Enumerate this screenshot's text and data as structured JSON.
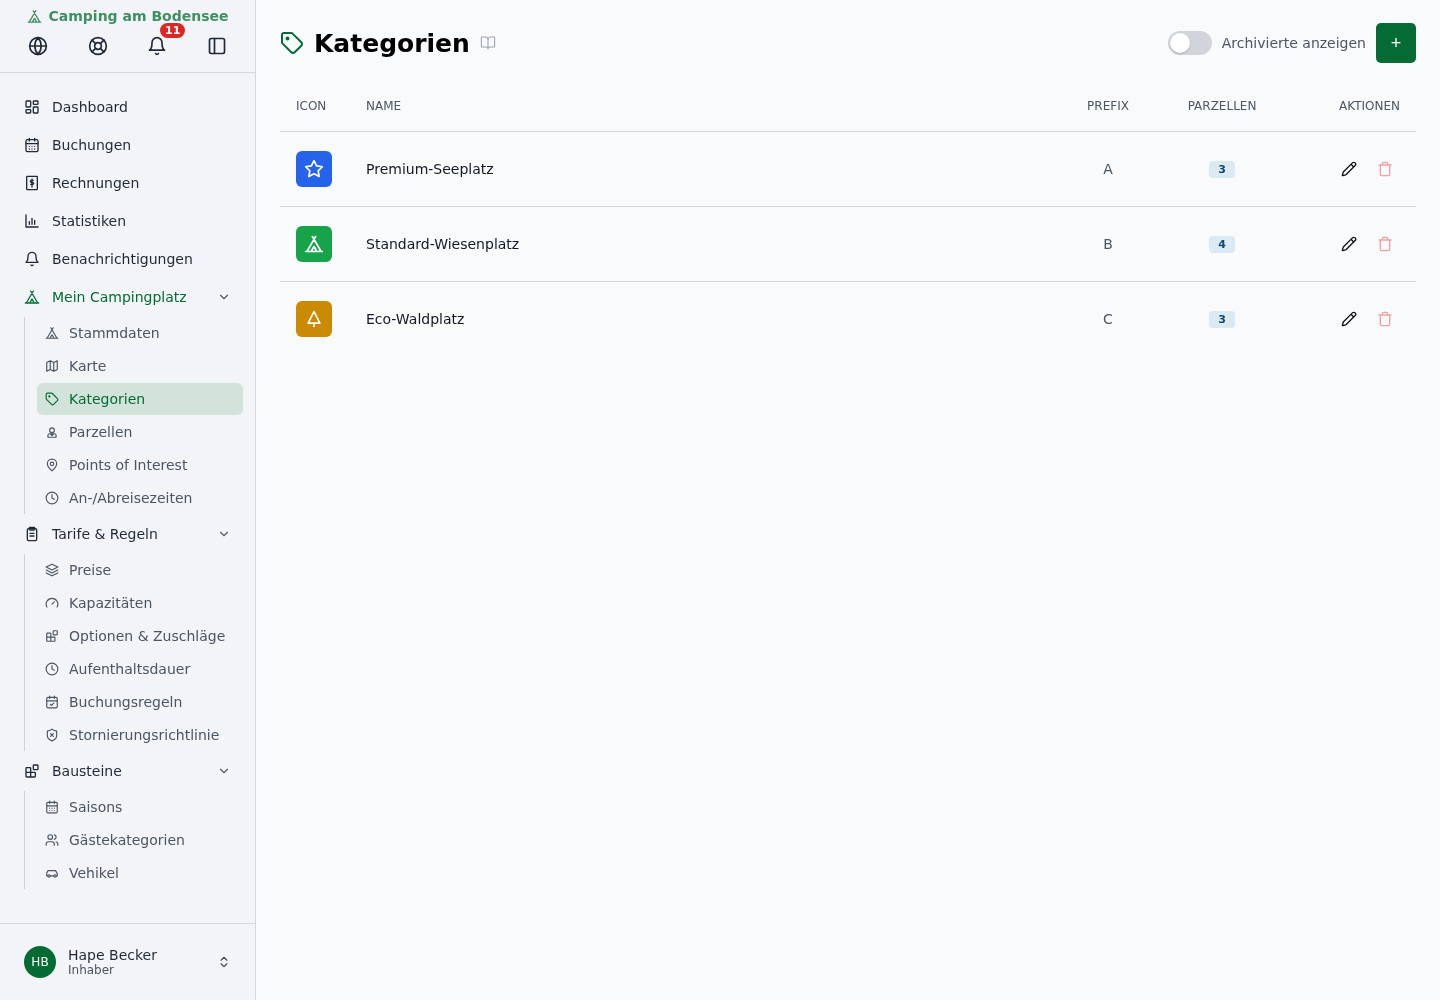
{
  "sidebar": {
    "brand": "Camping am Bodensee",
    "notifications_badge": "11",
    "nav": [
      {
        "label": "Dashboard",
        "selected": false
      },
      {
        "label": "Buchungen",
        "selected": false
      },
      {
        "label": "Rechnungen",
        "selected": false
      },
      {
        "label": "Statistiken",
        "selected": false
      },
      {
        "label": "Benachrichtigungen",
        "selected": false
      },
      {
        "label": "Mein Campingplatz",
        "selected": true,
        "expanded": true,
        "children": [
          {
            "label": "Stammdaten",
            "selected": false
          },
          {
            "label": "Karte",
            "selected": false
          },
          {
            "label": "Kategorien",
            "selected": true
          },
          {
            "label": "Parzellen",
            "selected": false
          },
          {
            "label": "Points of Interest",
            "selected": false
          },
          {
            "label": "An-/Abreisezeiten",
            "selected": false
          }
        ]
      },
      {
        "label": "Tarife & Regeln",
        "selected": false,
        "expanded": true,
        "children": [
          {
            "label": "Preise",
            "selected": false
          },
          {
            "label": "Kapazitäten",
            "selected": false
          },
          {
            "label": "Optionen & Zuschläge",
            "selected": false
          },
          {
            "label": "Aufenthaltsdauer",
            "selected": false
          },
          {
            "label": "Buchungsregeln",
            "selected": false
          },
          {
            "label": "Stornierungsrichtlinie",
            "selected": false
          }
        ]
      },
      {
        "label": "Bausteine",
        "selected": false,
        "expanded": true,
        "children": [
          {
            "label": "Saisons",
            "selected": false
          },
          {
            "label": "Gästekategorien",
            "selected": false
          },
          {
            "label": "Vehikel",
            "selected": false
          }
        ]
      }
    ],
    "user": {
      "initials": "HB",
      "name": "Hape Becker",
      "role": "Inhaber"
    }
  },
  "page": {
    "title": "Kategorien",
    "archived_toggle": {
      "label": "Archivierte anzeigen",
      "on": false
    },
    "add_button": "+"
  },
  "table": {
    "columns": [
      "ICON",
      "NAME",
      "PREFIX",
      "PARZELLEN",
      "AKTIONEN"
    ],
    "rows": [
      {
        "color": "#2563eb",
        "name": "Premium-Seeplatz",
        "prefix": "A",
        "parcels": "3"
      },
      {
        "color": "#16a34a",
        "name": "Standard-Wiesenplatz",
        "prefix": "B",
        "parcels": "4"
      },
      {
        "color": "#ca8a04",
        "name": "Eco-Waldplatz",
        "prefix": "C",
        "parcels": "3"
      }
    ]
  }
}
